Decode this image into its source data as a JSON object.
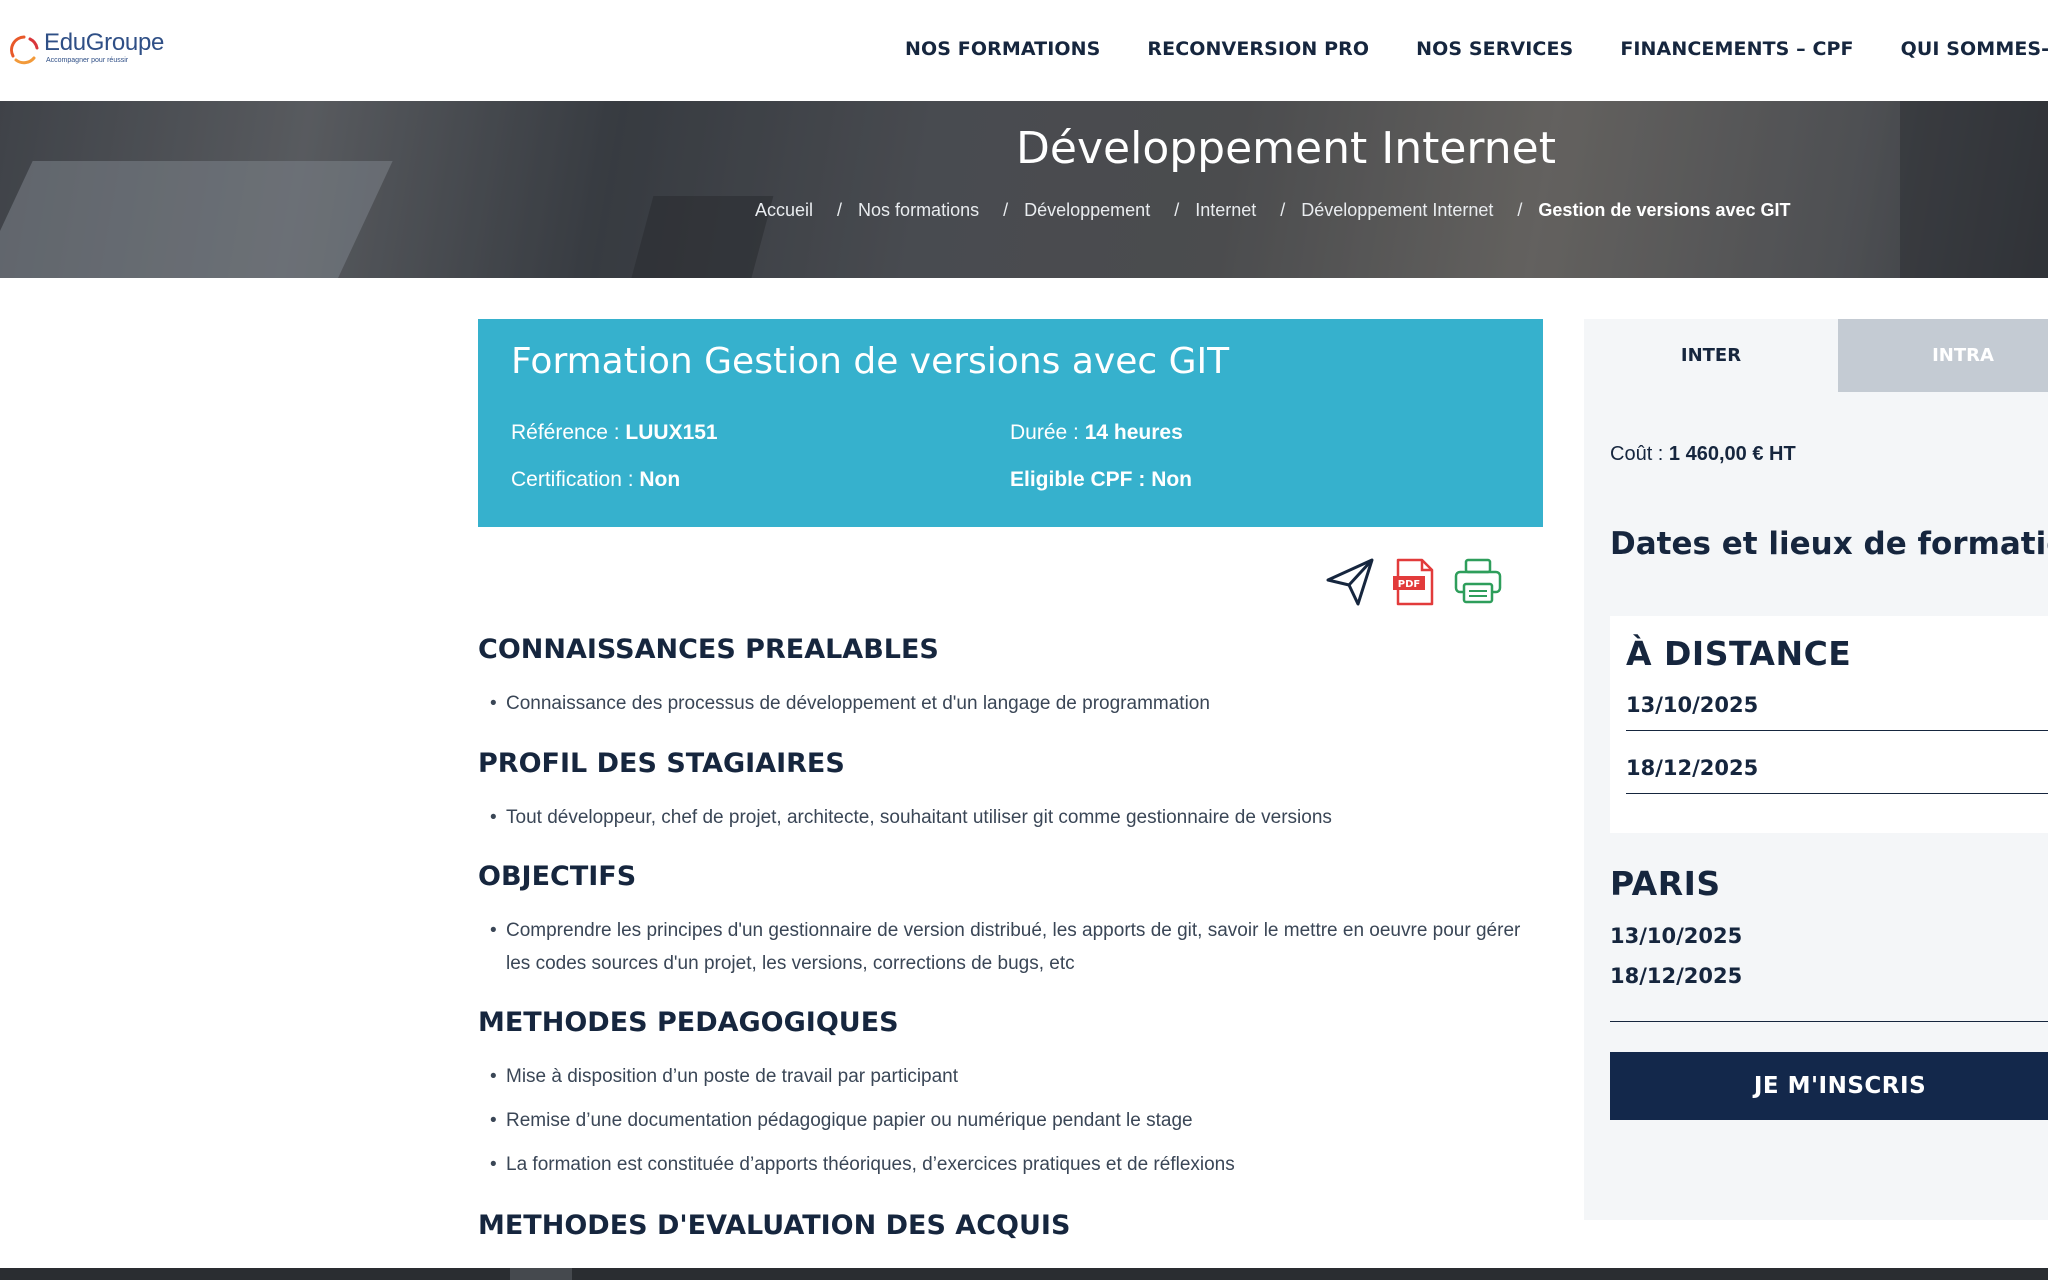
{
  "header": {
    "logo_name": "EduGroupe",
    "logo_tagline": "Accompagner pour réussir",
    "nav": [
      "NOS FORMATIONS",
      "RECONVERSION PRO",
      "NOS SERVICES",
      "FINANCEMENTS – CPF",
      "QUI SOMMES-NOUS"
    ]
  },
  "hero": {
    "title": "Développement Internet",
    "breadcrumb": [
      "Accueil",
      "Nos formations",
      "Développement",
      "Internet",
      "Développement Internet"
    ],
    "breadcrumb_current": "Gestion de versions avec GIT"
  },
  "course": {
    "title": "Formation Gestion de versions avec GIT",
    "reference_label": "Référence : ",
    "reference_value": "LUUX151",
    "duration_label": "Durée : ",
    "duration_value": "14 heures",
    "certification_label": "Certification : ",
    "certification_value": "Non",
    "cpf_label": "Eligible CPF : ",
    "cpf_value": "Non"
  },
  "actions": [
    "send-icon",
    "pdf-icon",
    "print-icon"
  ],
  "sections": {
    "prerequisites": {
      "title": "CONNAISSANCES PREALABLES",
      "items": [
        "Connaissance des processus de développement et d'un langage de programmation"
      ]
    },
    "profile": {
      "title": "PROFIL DES STAGIAIRES",
      "items": [
        "Tout développeur, chef de projet, architecte, souhaitant utiliser git comme gestionnaire de versions"
      ]
    },
    "objectives": {
      "title": "OBJECTIFS",
      "items": [
        "Comprendre les principes d'un gestionnaire de version distribué, les apports de git, savoir le mettre en oeuvre pour gérer les codes sources d'un projet, les versions, corrections de bugs, etc"
      ]
    },
    "methods": {
      "title": "METHODES PEDAGOGIQUES",
      "items": [
        "Mise à disposition d’un poste de travail par participant",
        "Remise d’une documentation pédagogique papier ou numérique pendant le stage",
        "La formation est constituée d’apports théoriques, d’exercices pratiques et de réflexions"
      ]
    },
    "evaluation": {
      "title": "METHODES D'EVALUATION DES ACQUIS"
    }
  },
  "sidebar": {
    "tabs": [
      "INTER",
      "INTRA"
    ],
    "cost_label": "Coût : ",
    "cost_value": "1 460,00 € HT",
    "dates_title": "Dates et lieux de formation",
    "distance": {
      "title": "À DISTANCE",
      "dates": [
        "13/10/2025",
        "18/12/2025"
      ]
    },
    "paris": {
      "title": "PARIS",
      "dates": [
        "13/10/2025",
        "18/12/2025"
      ]
    },
    "cta": "JE M'INSCRIS"
  },
  "colors": {
    "accent": "#36b1cd",
    "navy": "#13284b",
    "text": "#16263e"
  }
}
